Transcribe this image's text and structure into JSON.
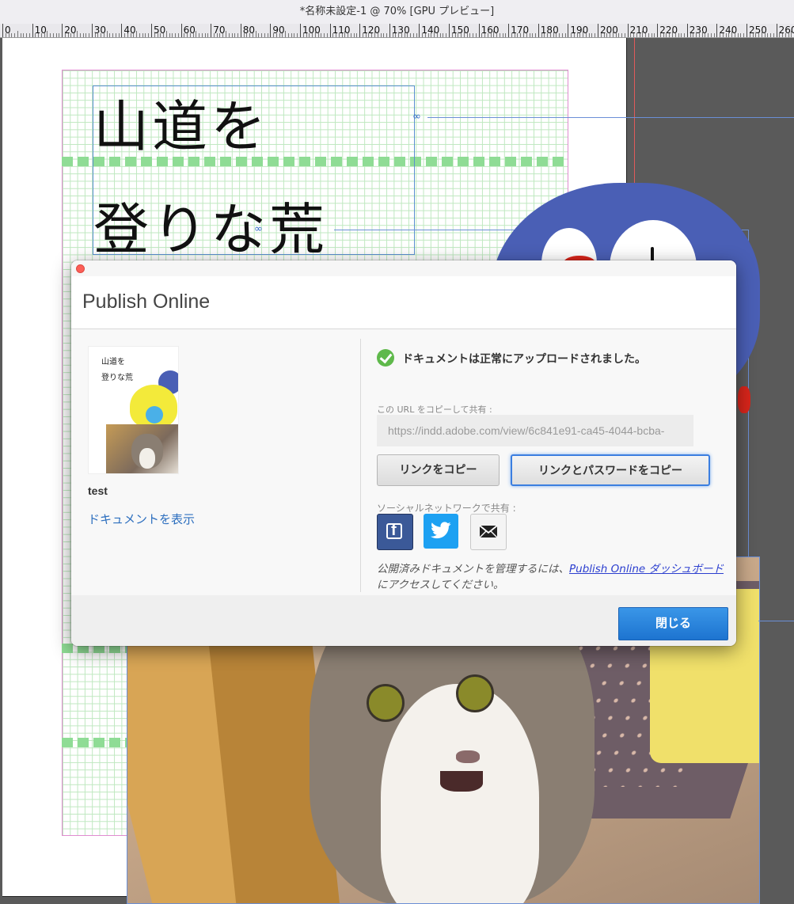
{
  "window": {
    "title": "*名称未設定-1 @ 70% [GPU プレビュー]"
  },
  "ruler": {
    "labels": [
      "0",
      "10",
      "20",
      "30",
      "40",
      "50",
      "60",
      "70",
      "80",
      "90",
      "100",
      "110",
      "120",
      "130",
      "140",
      "150",
      "160",
      "170",
      "180",
      "190",
      "200",
      "210",
      "220",
      "230",
      "240",
      "250",
      "260"
    ]
  },
  "canvas": {
    "text_line1": "山道を",
    "text_line2": "登りな荒"
  },
  "dialog": {
    "title": "Publish Online",
    "document": {
      "thumbnail_text_line1": "山道を",
      "thumbnail_text_line2": "登りな荒",
      "name": "test",
      "view_link": "ドキュメントを表示"
    },
    "status": {
      "icon": "check-icon",
      "color": "#5fb94b",
      "message": "ドキュメントは正常にアップロードされました。"
    },
    "url": {
      "label": "この URL をコピーして共有 :",
      "value": "https://indd.adobe.com/view/6c841e91-ca45-4044-bcba-"
    },
    "buttons": {
      "copy_link": "リンクをコピー",
      "copy_link_password": "リンクとパスワードをコピー",
      "close": "閉じる"
    },
    "social": {
      "label": "ソーシャルネットワークで共有 :",
      "items": [
        {
          "name": "facebook-icon",
          "color": "#3b5998"
        },
        {
          "name": "twitter-icon",
          "color": "#1da1f2"
        },
        {
          "name": "mail-icon",
          "color": "#f4f4f4"
        }
      ]
    },
    "manage": {
      "prefix": "公開済みドキュメントを管理するには、",
      "link": "Publish Online ダッシュボード",
      "suffix": "にアクセスしてください。"
    },
    "accent_color": "#1d74d0"
  }
}
